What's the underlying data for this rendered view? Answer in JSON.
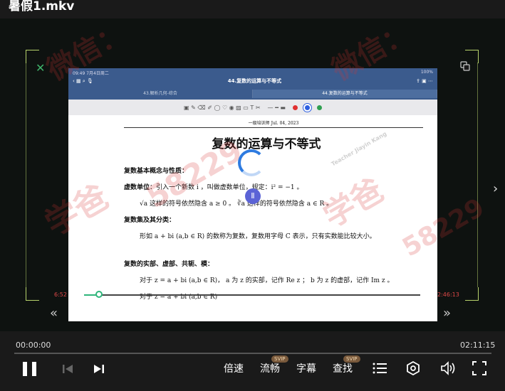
{
  "window": {
    "title": "暑假1.mkv"
  },
  "ipad": {
    "status_time": "09:49  7月4日周二",
    "status_battery": "100%",
    "document_title": "44.复数的运算与不等式",
    "tabs": [
      "43.解析几何-综合",
      "44.复数的运算与不等式"
    ]
  },
  "page": {
    "header": "一级培训师  Jul. 04, 2023",
    "title": "复数的运算与不等式",
    "section1": "复数基本概念与性质：",
    "line1_bold": "虚数单位",
    "line1": "：引入一个新数 i ，叫做虚数单位，规定：i² = −1 。",
    "line2": "√a 这样的符号依然隐含 a ≥ 0 。 ∛a 这样的符号依然隐含 a ∈ R 。",
    "section2": "复数集及其分类：",
    "line3": "形如 a + bi (a,b ∈ R) 的数称为复数，复数用字母 C 表示，只有实数能比较大小。",
    "section3": "复数的实部、虚部、共轭、模：",
    "line4": "对于 z = a + bi (a,b ∈ R)， a 为 z 的实部，记作 Re z ；  b 为 z 的虚部，记作 Im z 。",
    "line5": "对于 z = a + bi (a,b ∈ R)"
  },
  "watermark": {
    "text1": "学爸",
    "text2": "微信：",
    "number": "58229",
    "teacher": "Teacher Jiayin Kang"
  },
  "inner_player": {
    "time_left": "6:52",
    "time_right": "2:46:13",
    "progress": 0.04
  },
  "player": {
    "current_time": "00:00:00",
    "total_time": "02:11:15",
    "progress": 0.0,
    "speed_label": "倍速",
    "quality_label": "流畅",
    "subtitle_label": "字幕",
    "search_label": "查找",
    "svip_badge": "SVIP"
  },
  "colors": {
    "accent": "#2fb57b",
    "frame": "#b7d36b",
    "watermark": "#d63232"
  }
}
